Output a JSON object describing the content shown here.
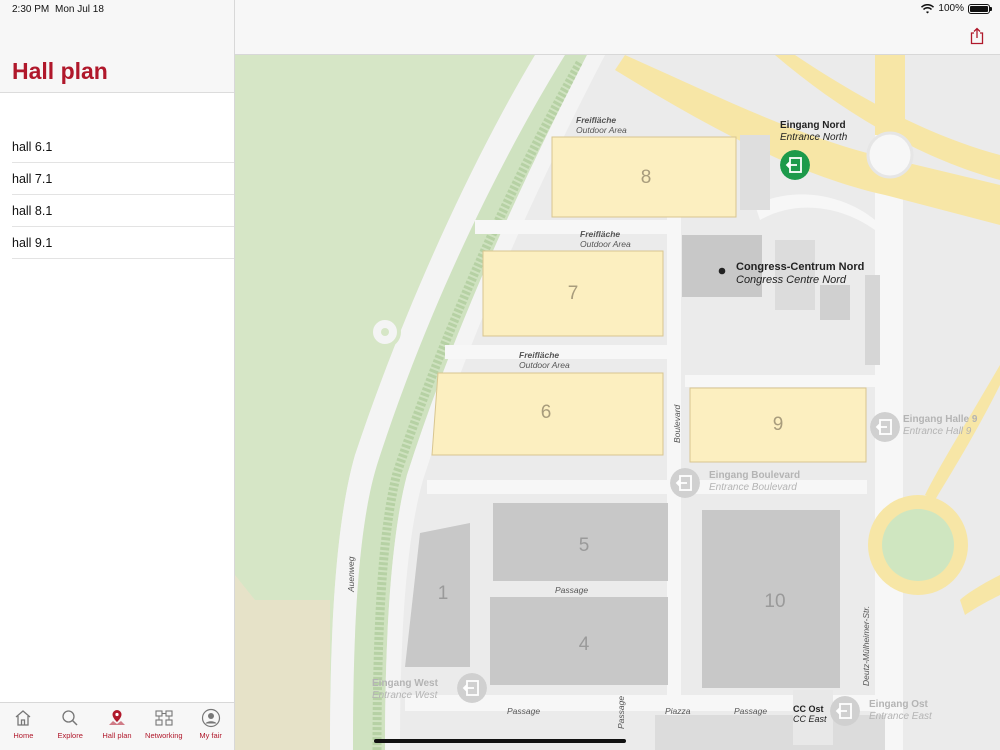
{
  "status_bar": {
    "time": "2:30 PM",
    "date": "Mon Jul 18",
    "battery": "100%",
    "wifi_icon": "wifi-icon"
  },
  "sidebar": {
    "title": "Hall plan",
    "halls": [
      "hall 6.1",
      "hall 7.1",
      "hall 8.1",
      "hall 9.1"
    ]
  },
  "tabbar": {
    "accent": "#b0182b",
    "items": [
      {
        "label": "Home",
        "icon": "home-icon"
      },
      {
        "label": "Explore",
        "icon": "search-icon"
      },
      {
        "label": "Hall plan",
        "icon": "map-pin-icon"
      },
      {
        "label": "Networking",
        "icon": "networking-icon"
      },
      {
        "label": "My fair",
        "icon": "person-icon"
      }
    ]
  },
  "topbar": {
    "share_icon": "share-icon"
  },
  "map": {
    "halls": {
      "h8": "8",
      "h7": "7",
      "h6": "6",
      "h9": "9",
      "h5": "5",
      "h1": "1",
      "h4": "4",
      "h10": "10"
    },
    "outdoor": {
      "de": "Freifläche",
      "en": "Outdoor Area"
    },
    "entrances": {
      "north": {
        "de": "Eingang Nord",
        "en": "Entrance North"
      },
      "hall9": {
        "de": "Eingang Halle 9",
        "en": "Entrance Hall 9"
      },
      "boulevard": {
        "de": "Eingang Boulevard",
        "en": "Entrance Boulevard"
      },
      "west": {
        "de": "Eingang West",
        "en": "Entrance West"
      },
      "east": {
        "de": "Eingang Ost",
        "en": "Entrance East"
      },
      "cc_east": {
        "de": "CC Ost",
        "en": "CC East"
      }
    },
    "poi": {
      "de": "Congress-Centrum Nord",
      "en": "Congress Centre Nord"
    },
    "streets": {
      "boulevard": "Boulevard",
      "auenweg": "Auenweg",
      "deutz": "Deutz-Mülheimer-Str.",
      "passage": "Passage",
      "piazza": "Piazza"
    },
    "colors": {
      "hall_highlight": "#fcefc0",
      "hall_grey": "#c8c8c8",
      "park": "#d6e6c6",
      "road": "#f7e6a6",
      "entrance_active": "#1d9a4b"
    }
  }
}
